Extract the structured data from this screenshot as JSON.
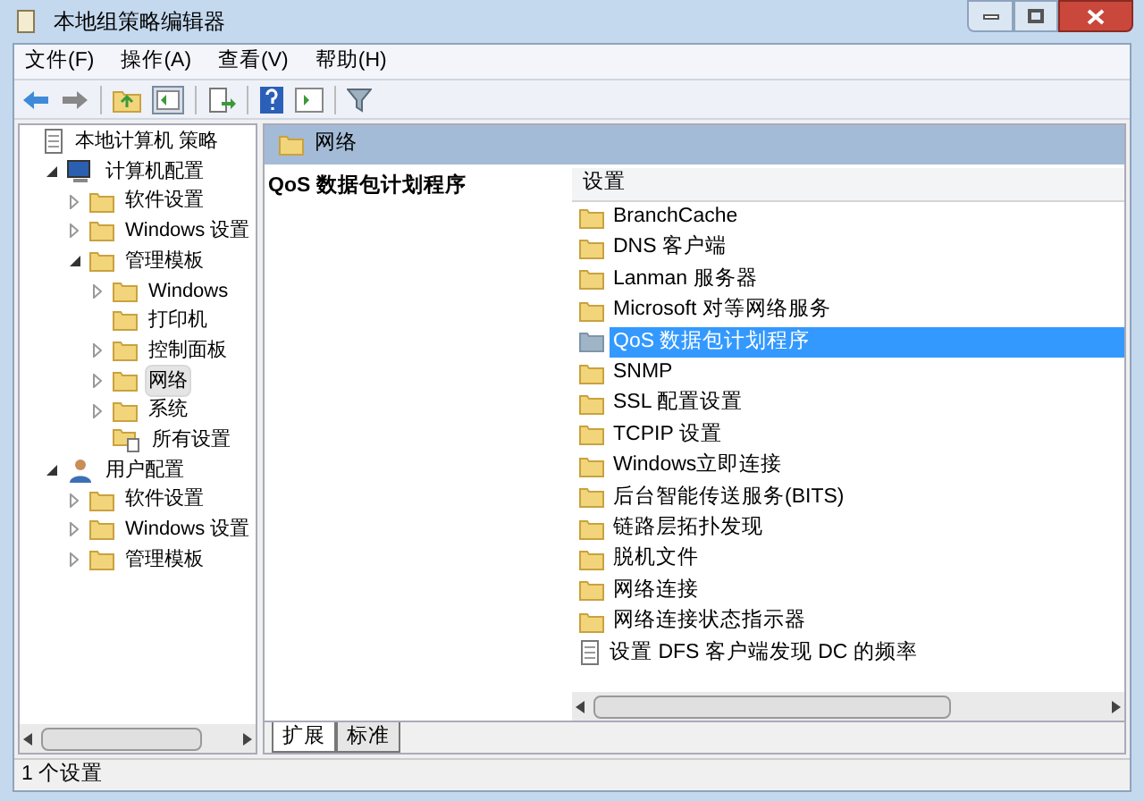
{
  "window": {
    "title": "本地组策略编辑器"
  },
  "menu": [
    "文件(F)",
    "操作(A)",
    "查看(V)",
    "帮助(H)"
  ],
  "tree": [
    {
      "label": "本地计算机 策略",
      "kind": "policy",
      "expandable": false,
      "selected": false,
      "children": [
        {
          "label": "计算机配置",
          "kind": "computer",
          "expandable": true,
          "expanded": true,
          "selected": false,
          "children": [
            {
              "label": "软件设置",
              "kind": "folder",
              "expandable": true,
              "expanded": false,
              "selected": false
            },
            {
              "label": "Windows 设置",
              "kind": "folder",
              "expandable": true,
              "expanded": false,
              "selected": false
            },
            {
              "label": "管理模板",
              "kind": "folder",
              "expandable": true,
              "expanded": true,
              "selected": false,
              "children": [
                {
                  "label": "Windows",
                  "kind": "folder",
                  "expandable": true,
                  "expanded": false,
                  "selected": false
                },
                {
                  "label": "打印机",
                  "kind": "folder",
                  "expandable": false,
                  "selected": false
                },
                {
                  "label": "控制面板",
                  "kind": "folder",
                  "expandable": true,
                  "expanded": false,
                  "selected": false
                },
                {
                  "label": "网络",
                  "kind": "folder",
                  "expandable": true,
                  "expanded": false,
                  "selected": true
                },
                {
                  "label": "系统",
                  "kind": "folder",
                  "expandable": true,
                  "expanded": false,
                  "selected": false
                },
                {
                  "label": "所有设置",
                  "kind": "all",
                  "expandable": false,
                  "selected": false
                }
              ]
            }
          ]
        },
        {
          "label": "用户配置",
          "kind": "user",
          "expandable": true,
          "expanded": true,
          "selected": false,
          "children": [
            {
              "label": "软件设置",
              "kind": "folder",
              "expandable": true,
              "expanded": false,
              "selected": false
            },
            {
              "label": "Windows 设置",
              "kind": "folder",
              "expandable": true,
              "expanded": false,
              "selected": false
            },
            {
              "label": "管理模板",
              "kind": "folder",
              "expandable": true,
              "expanded": false,
              "selected": false
            }
          ]
        }
      ]
    }
  ],
  "pane_header": "网络",
  "description_title": "QoS 数据包计划程序",
  "list": {
    "column": "设置",
    "rows": [
      {
        "label": "BranchCache",
        "kind": "folder",
        "selected": false
      },
      {
        "label": "DNS 客户端",
        "kind": "folder",
        "selected": false
      },
      {
        "label": "Lanman 服务器",
        "kind": "folder",
        "selected": false
      },
      {
        "label": "Microsoft 对等网络服务",
        "kind": "folder",
        "selected": false
      },
      {
        "label": "QoS 数据包计划程序",
        "kind": "folder",
        "selected": true
      },
      {
        "label": "SNMP",
        "kind": "folder",
        "selected": false
      },
      {
        "label": "SSL 配置设置",
        "kind": "folder",
        "selected": false
      },
      {
        "label": "TCPIP 设置",
        "kind": "folder",
        "selected": false
      },
      {
        "label": "Windows立即连接",
        "kind": "folder",
        "selected": false
      },
      {
        "label": "后台智能传送服务(BITS)",
        "kind": "folder",
        "selected": false
      },
      {
        "label": "链路层拓扑发现",
        "kind": "folder",
        "selected": false
      },
      {
        "label": "脱机文件",
        "kind": "folder",
        "selected": false
      },
      {
        "label": "网络连接",
        "kind": "folder",
        "selected": false
      },
      {
        "label": "网络连接状态指示器",
        "kind": "folder",
        "selected": false
      },
      {
        "label": "设置 DFS 客户端发现 DC 的频率",
        "kind": "setting",
        "selected": false
      }
    ]
  },
  "tabs": [
    {
      "label": "扩展",
      "selected": true
    },
    {
      "label": "标准",
      "selected": false
    }
  ],
  "status_bar": "1 个设置"
}
